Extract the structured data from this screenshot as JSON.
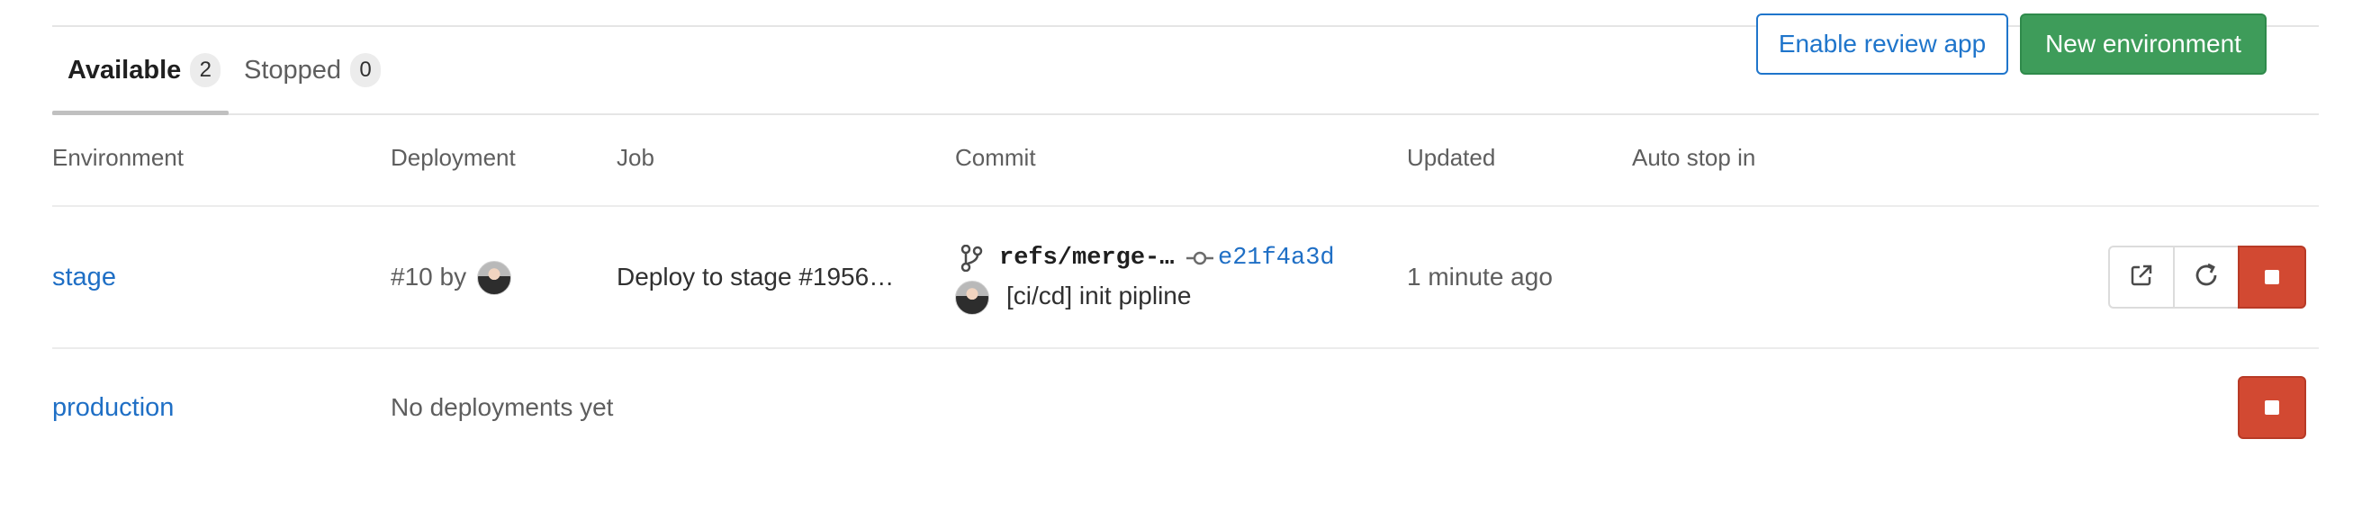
{
  "tabs": [
    {
      "label": "Available",
      "count": "2"
    },
    {
      "label": "Stopped",
      "count": "0"
    }
  ],
  "buttons": {
    "enable_review_app": "Enable review app",
    "new_environment": "New environment"
  },
  "table": {
    "headers": [
      "Environment",
      "Deployment",
      "Job",
      "Commit",
      "Updated",
      "Auto stop in"
    ],
    "rows": [
      {
        "environment": "stage",
        "deployment": "#10 by",
        "job": "Deploy to stage #1956…",
        "ref": "refs/merge-…",
        "sha": "e21f4a3d",
        "commit_title": "[ci/cd] init pipline",
        "updated": "1 minute ago"
      },
      {
        "environment": "production",
        "deployment": "No deployments yet"
      }
    ]
  },
  "colors": {
    "link": "#1f6fc5",
    "primary_green": "#3e9c5a",
    "danger_red": "#d24932"
  }
}
